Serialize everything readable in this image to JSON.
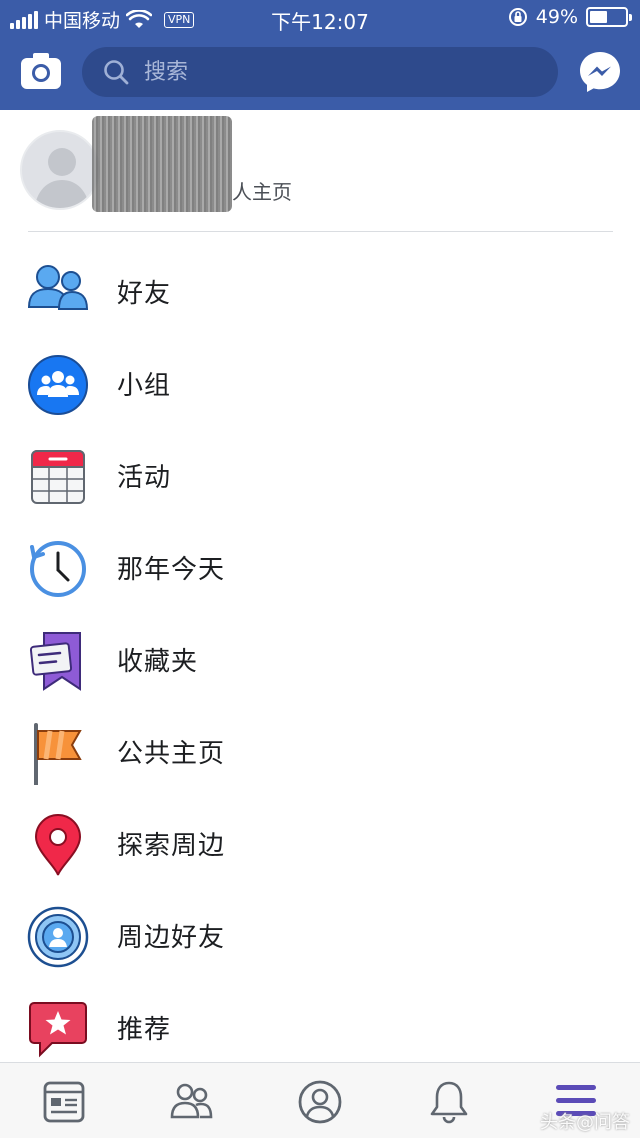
{
  "status_bar": {
    "carrier": "中国移动",
    "vpn": "VPN",
    "time": "下午12:07",
    "battery_percent": "49%",
    "battery_level": 0.49
  },
  "header": {
    "search_placeholder": "搜索"
  },
  "profile": {
    "subtitle": "人主页"
  },
  "menu": {
    "items": [
      {
        "label": "好友",
        "icon": "friends-icon"
      },
      {
        "label": "小组",
        "icon": "groups-icon"
      },
      {
        "label": "活动",
        "icon": "events-calendar-icon"
      },
      {
        "label": "那年今天",
        "icon": "memories-clock-icon"
      },
      {
        "label": "收藏夹",
        "icon": "saved-bookmark-icon"
      },
      {
        "label": "公共主页",
        "icon": "pages-flag-icon"
      },
      {
        "label": "探索周边",
        "icon": "location-pin-icon"
      },
      {
        "label": "周边好友",
        "icon": "nearby-friends-icon"
      },
      {
        "label": "推荐",
        "icon": "recommendations-star-icon"
      }
    ]
  },
  "tabbar": {
    "tabs": [
      "news-feed-icon",
      "friends-tab-icon",
      "profile-tab-icon",
      "notifications-bell-icon",
      "menu-tab-icon"
    ],
    "watermark": "头条@问答"
  },
  "colors": {
    "brand_blue": "#3b5ca8",
    "search_bg": "#2e4a8c",
    "active_tab": "#5b4bb7"
  }
}
